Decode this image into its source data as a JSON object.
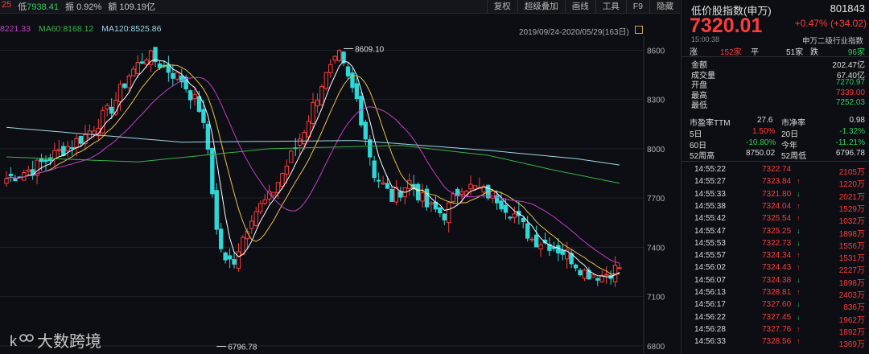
{
  "top": {
    "prefix": "25",
    "low_label": "低",
    "low": "7938.41",
    "amp_label": "振",
    "amp": "0.92%",
    "amount_label": "额",
    "amount": "109.19亿",
    "menu": [
      "复权",
      "超级叠加",
      "画线",
      "工具",
      "F9",
      "隐藏"
    ]
  },
  "ma": {
    "ma_first": "8221.33",
    "ma60": "MA60:8168.12",
    "ma120": "MA120:8525.86",
    "range": "2019/09/24-2020/05/29(163日)"
  },
  "watermark": "大数跨境",
  "colors": {
    "up": "#ff3b3b",
    "down": "#2fd7d7",
    "ma5": "#ffffff",
    "ma10": "#e8c24a",
    "ma20": "#c040c0",
    "ma60": "#3cb04a",
    "ma120": "#9fd6e6"
  },
  "chart_data": {
    "type": "candlestick",
    "ylim": [
      6780,
      8680
    ],
    "yticks": [
      8600,
      8300,
      8000,
      7700,
      7400,
      7100,
      6800
    ],
    "x_range": [
      "2019/09/24",
      "2020/05/29"
    ],
    "trading_days": 163,
    "annotations": [
      {
        "text": "8609.10",
        "kind": "high"
      },
      {
        "text": "6796.78",
        "kind": "low"
      }
    ],
    "series": [
      {
        "name": "MA60",
        "values_at_anchor": [
          [
            0,
            7950
          ],
          [
            30,
            7920
          ],
          [
            60,
            8000
          ],
          [
            90,
            8020
          ],
          [
            110,
            7960
          ],
          [
            125,
            7870
          ],
          [
            140,
            7790
          ],
          [
            148,
            7710
          ]
        ]
      },
      {
        "name": "MA120",
        "values_at_anchor": [
          [
            0,
            8130
          ],
          [
            40,
            8040
          ],
          [
            80,
            8050
          ],
          [
            110,
            7990
          ],
          [
            130,
            7940
          ],
          [
            148,
            7870
          ]
        ]
      }
    ],
    "close_path": [
      [
        0,
        7820
      ],
      [
        6,
        7880
      ],
      [
        12,
        7980
      ],
      [
        18,
        8080
      ],
      [
        24,
        8250
      ],
      [
        28,
        8450
      ],
      [
        32,
        8570
      ],
      [
        36,
        8500
      ],
      [
        40,
        8420
      ],
      [
        44,
        8250
      ],
      [
        46,
        8000
      ],
      [
        48,
        7500
      ],
      [
        50,
        7300
      ],
      [
        52,
        7330
      ],
      [
        56,
        7600
      ],
      [
        60,
        7700
      ],
      [
        64,
        7900
      ],
      [
        68,
        8120
      ],
      [
        72,
        8400
      ],
      [
        76,
        8560
      ],
      [
        78,
        8420
      ],
      [
        80,
        8300
      ],
      [
        84,
        7850
      ],
      [
        88,
        7700
      ],
      [
        92,
        7800
      ],
      [
        96,
        7650
      ],
      [
        100,
        7600
      ],
      [
        104,
        7780
      ],
      [
        108,
        7750
      ],
      [
        112,
        7700
      ],
      [
        116,
        7600
      ],
      [
        120,
        7450
      ],
      [
        124,
        7420
      ],
      [
        128,
        7360
      ],
      [
        132,
        7250
      ],
      [
        136,
        7230
      ],
      [
        140,
        7280
      ]
    ]
  },
  "side": {
    "title": "低价股指数(申万)",
    "code": "801843",
    "price": "7320.01",
    "change": "+0.47% (+34.02)",
    "time": "15:00:38",
    "industry": "申万二级行业指数",
    "breadth": {
      "up_label": "涨",
      "up": "152家",
      "flat_label": "平",
      "flat": "51家",
      "down_label": "跌",
      "down": "96家"
    },
    "stats": [
      {
        "label": "金额",
        "value": "202.47亿",
        "cls": "white"
      },
      {
        "label": "成交量",
        "value": "67.40亿",
        "cls": "white"
      },
      {
        "label": "开盘",
        "value": "7270.97",
        "cls": "green"
      },
      {
        "label": "最高",
        "value": "7339.00",
        "cls": "red"
      },
      {
        "label": "最低",
        "value": "7252.03",
        "cls": "green"
      }
    ],
    "pe": {
      "l1": "市盈率TTM",
      "v1": "27.6",
      "l2": "市净率",
      "v2": "0.98"
    },
    "periods": [
      {
        "l1": "5日",
        "v1": "1.50%",
        "c1": "red",
        "l2": "20日",
        "v2": "-1.32%",
        "c2": "green"
      },
      {
        "l1": "60日",
        "v1": "-10.80%",
        "c1": "green",
        "l2": "今年",
        "v2": "-11.21%",
        "c2": "green"
      },
      {
        "l1": "52周高",
        "v1": "8750.02",
        "c1": "white",
        "l2": "52周低",
        "v2": "6796.78",
        "c2": "white"
      }
    ],
    "ticks": [
      {
        "t": "14:55:22",
        "p": "7322.74",
        "a": "",
        "v": "2105万"
      },
      {
        "t": "14:55:27",
        "p": "7323.84",
        "a": "up",
        "v": "1220万"
      },
      {
        "t": "14:55:33",
        "p": "7321.80",
        "a": "down",
        "v": "2021万"
      },
      {
        "t": "14:55:38",
        "p": "7324.04",
        "a": "up",
        "v": "1529万"
      },
      {
        "t": "14:55:42",
        "p": "7325.54",
        "a": "up",
        "v": "1032万"
      },
      {
        "t": "14:55:47",
        "p": "7325.25",
        "a": "down",
        "v": "1898万"
      },
      {
        "t": "14:55:53",
        "p": "7322.73",
        "a": "down",
        "v": "1556万"
      },
      {
        "t": "14:55:57",
        "p": "7324.34",
        "a": "up",
        "v": "1531万"
      },
      {
        "t": "14:56:02",
        "p": "7324.43",
        "a": "up",
        "v": "2227万"
      },
      {
        "t": "14:56:07",
        "p": "7324.38",
        "a": "down",
        "v": "1898万"
      },
      {
        "t": "14:56:13",
        "p": "7328.81",
        "a": "up",
        "v": "2403万"
      },
      {
        "t": "14:56:17",
        "p": "7327.60",
        "a": "down",
        "v": "836万"
      },
      {
        "t": "14:56:22",
        "p": "7327.45",
        "a": "down",
        "v": "1962万"
      },
      {
        "t": "14:56:28",
        "p": "7327.76",
        "a": "up",
        "v": "1892万"
      },
      {
        "t": "14:56:33",
        "p": "7328.56",
        "a": "up",
        "v": "1369万"
      }
    ]
  }
}
